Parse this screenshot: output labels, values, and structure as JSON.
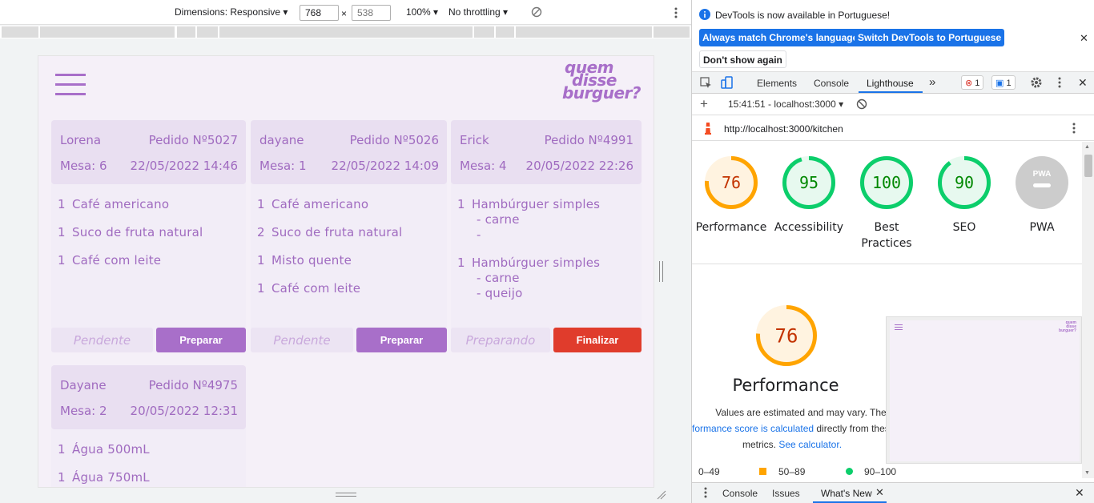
{
  "device_toolbar": {
    "dimensions_label": "Dimensions: Responsive",
    "width_value": "768",
    "height_value": "538",
    "times": "×",
    "zoom": "100%",
    "throttling": "No throttling"
  },
  "app": {
    "logo_lines": [
      "quem",
      "disse",
      "burguer?"
    ],
    "orders": [
      {
        "client": "Lorena",
        "order_no": "Pedido Nº5027",
        "table": "Mesa: 6",
        "datetime": "22/05/2022 14:46",
        "items": [
          {
            "qty": "1",
            "name": "Café americano",
            "subs": []
          },
          {
            "qty": "1",
            "name": "Suco de fruta natural",
            "subs": []
          },
          {
            "qty": "1",
            "name": "Café com leite",
            "subs": []
          }
        ],
        "status": "Pendente",
        "action": "Preparar"
      },
      {
        "client": "dayane",
        "order_no": "Pedido Nº5026",
        "table": "Mesa: 1",
        "datetime": "22/05/2022 14:09",
        "items": [
          {
            "qty": "1",
            "name": "Café americano",
            "subs": []
          },
          {
            "qty": "2",
            "name": "Suco de fruta natural",
            "subs": []
          },
          {
            "qty": "1",
            "name": "Misto quente",
            "subs": []
          },
          {
            "qty": "1",
            "name": "Café com leite",
            "subs": []
          }
        ],
        "status": "Pendente",
        "action": "Preparar"
      },
      {
        "client": "Erick",
        "order_no": "Pedido Nº4991",
        "table": "Mesa: 4",
        "datetime": "20/05/2022 22:26",
        "items": [
          {
            "qty": "1",
            "name": "Hambúrguer simples",
            "subs": [
              "- carne",
              "-"
            ]
          },
          {
            "qty": "1",
            "name": "Hambúrguer simples",
            "subs": [
              "- carne",
              "- queijo"
            ]
          }
        ],
        "status": "Preparando",
        "action": "Finalizar"
      },
      {
        "client": "Dayane",
        "order_no": "Pedido Nº4975",
        "table": "Mesa: 2",
        "datetime": "20/05/2022 12:31",
        "items": [
          {
            "qty": "1",
            "name": "Água 500mL",
            "subs": []
          },
          {
            "qty": "1",
            "name": "Água 750mL",
            "subs": []
          }
        ],
        "status": "",
        "action": ""
      }
    ]
  },
  "devtools": {
    "info_message": "DevTools is now available in Portuguese!",
    "btn_match": "Always match Chrome's language",
    "btn_switch": "Switch DevTools to Portuguese",
    "btn_dont_show": "Don't show again",
    "tabs": [
      "Elements",
      "Console",
      "Lighthouse"
    ],
    "active_tab": "Lighthouse",
    "error_count": "1",
    "message_count": "1",
    "report_time": "15:41:51 - localhost:3000",
    "url": "http://localhost:3000/kitchen",
    "scores": [
      {
        "label": "Performance",
        "value": "76",
        "score": 76,
        "color": "#ffa400"
      },
      {
        "label": "Accessibility",
        "value": "95",
        "score": 95,
        "color": "#0cce6b"
      },
      {
        "label": "Best Practices",
        "value": "100",
        "score": 100,
        "color": "#0cce6b"
      },
      {
        "label": "SEO",
        "value": "90",
        "score": 90,
        "color": "#0cce6b"
      },
      {
        "label": "PWA",
        "value": "PWA",
        "score": 0,
        "color": "#cccccc"
      }
    ],
    "perf_big_value": "76",
    "perf_big_label": "Performance",
    "perf_desc_1": "Values are estimated and may vary. The",
    "perf_desc_link": "formance score is calculated",
    "perf_desc_2": "directly from thes",
    "perf_desc_3": "metrics.",
    "perf_desc_link2": "See calculator.",
    "legend": [
      "0–49",
      "50–89",
      "90–100"
    ],
    "drawer_tabs": [
      "Console",
      "Issues",
      "What's New"
    ]
  },
  "colors": {
    "accent_purple": "#a86fc9",
    "finalize_red": "#e03c2c",
    "devtools_blue": "#1a73e8"
  }
}
